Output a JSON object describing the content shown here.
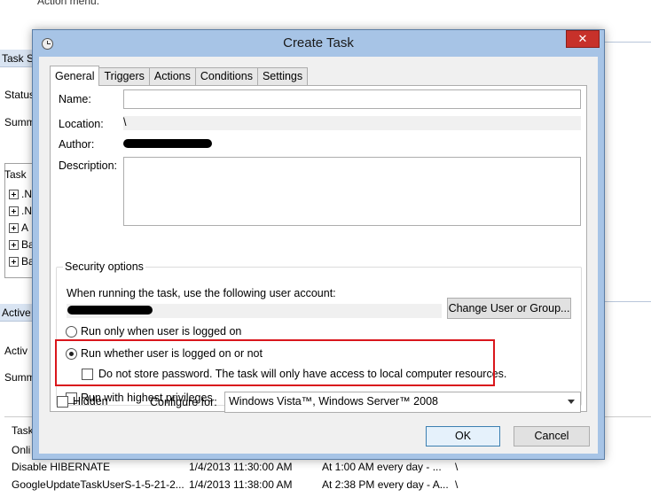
{
  "background": {
    "top_text": "Action menu.",
    "strip1": "Task Sta",
    "status_label": "Status",
    "summary_label": "Summ",
    "tasks_header": "Task",
    "tree_items": [
      ".N",
      ".N",
      "A",
      "Ba",
      "Ba",
      "..."
    ],
    "strip2": "Active T",
    "active_label": "Activ",
    "summary2_label": "Summ",
    "list_header": "Task",
    "rows": [
      {
        "name": "Onli",
        "date": "",
        "trigger": "",
        "extra": ""
      },
      {
        "name": "Disable HIBERNATE",
        "date": "1/4/2013 11:30:00 AM",
        "trigger": "At 1:00 AM every day - ...",
        "extra": "\\"
      },
      {
        "name": "GoogleUpdateTaskUserS-1-5-21-2...",
        "date": "1/4/2013 11:38:00 AM",
        "trigger": "At 2:38 PM every day - A...",
        "extra": "\\"
      }
    ]
  },
  "dialog": {
    "title": "Create Task",
    "close_glyph": "✕",
    "tabs": [
      "General",
      "Triggers",
      "Actions",
      "Conditions",
      "Settings"
    ],
    "name_label": "Name:",
    "name_value": "",
    "location_label": "Location:",
    "location_value": "\\",
    "author_label": "Author:",
    "description_label": "Description:",
    "description_value": "",
    "security": {
      "title": "Security options",
      "account_prompt": "When running the task, use the following user account:",
      "change_button": "Change User or Group...",
      "radio_logged_on": "Run only when user is logged on",
      "radio_whether": "Run whether user is logged on or not",
      "no_store_password": "Do not store password.  The task will only have access to local computer resources.",
      "highest_privileges": "Run with highest privileges"
    },
    "hidden_label": "Hidden",
    "configure_label": "Configure for:",
    "configure_value": "Windows Vista™, Windows Server™ 2008",
    "ok_button": "OK",
    "cancel_button": "Cancel"
  },
  "colors": {
    "highlight": "#d9161c",
    "titlebar": "#a7c4e6",
    "close": "#c7312a"
  }
}
